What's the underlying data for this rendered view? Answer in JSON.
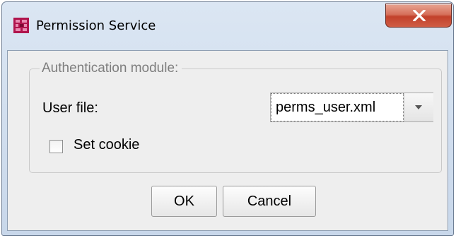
{
  "window": {
    "title": "Permission Service",
    "close_glyph": "X",
    "app_icon": "app-icon"
  },
  "group": {
    "title": "Authentication module:"
  },
  "user_file": {
    "label": "User file:",
    "selected": "perms_user.xml"
  },
  "cookie": {
    "label": "Set cookie",
    "checked": false
  },
  "buttons": {
    "ok": "OK",
    "cancel": "Cancel"
  },
  "colors": {
    "client_bg": "#eeeeee",
    "close_button": "#c2412b",
    "app_icon": "#b0154d"
  }
}
